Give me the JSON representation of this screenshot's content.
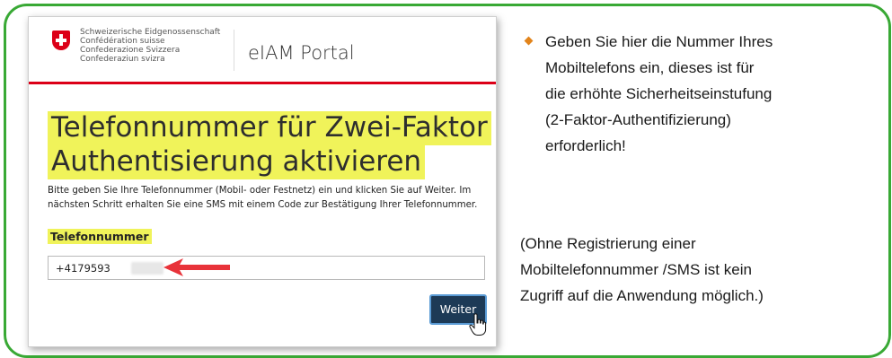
{
  "portal": {
    "confederation_lines": [
      "Schweizerische Eidgenossenschaft",
      "Confédération suisse",
      "Confederazione Svizzera",
      "Confederaziun svizra"
    ],
    "name": "eIAM Portal"
  },
  "form": {
    "title_line1": "Telefonnummer für Zwei-Faktor",
    "title_line2": "Authentisierung aktivieren",
    "description": "Bitte geben Sie Ihre Telefonnummer (Mobil- oder Festnetz) ein und klicken Sie auf Weiter. Im nächsten Schritt erhalten Sie eine SMS mit einem Code zur Bestätigung Ihrer Telefonnummer.",
    "field_label": "Telefonnummer",
    "phone_value": "+4179593",
    "submit_label": "Weiter"
  },
  "info": {
    "bullet": "Geben Sie hier die Nummer Ihres\nMobiltelefons ein, dieses ist für\ndie erhöhte Sicherheitseinstufung\n(2-Faktor-Authentifizierung)\nerforderlich!",
    "note": "(Ohne Registrierung einer\nMobiltelefonnummer /SMS ist kein\nZugriff auf die Anwendung möglich.)"
  },
  "colors": {
    "frame": "#39a935",
    "highlight": "#f0f35a",
    "swiss_red": "#dc0018",
    "button": "#1d3a56",
    "bullet": "#e2841b",
    "arrow": "#e8333a"
  },
  "icons": [
    "swiss-cross-icon",
    "red-arrow-icon",
    "hand-cursor-icon",
    "diamond-bullet-icon"
  ]
}
